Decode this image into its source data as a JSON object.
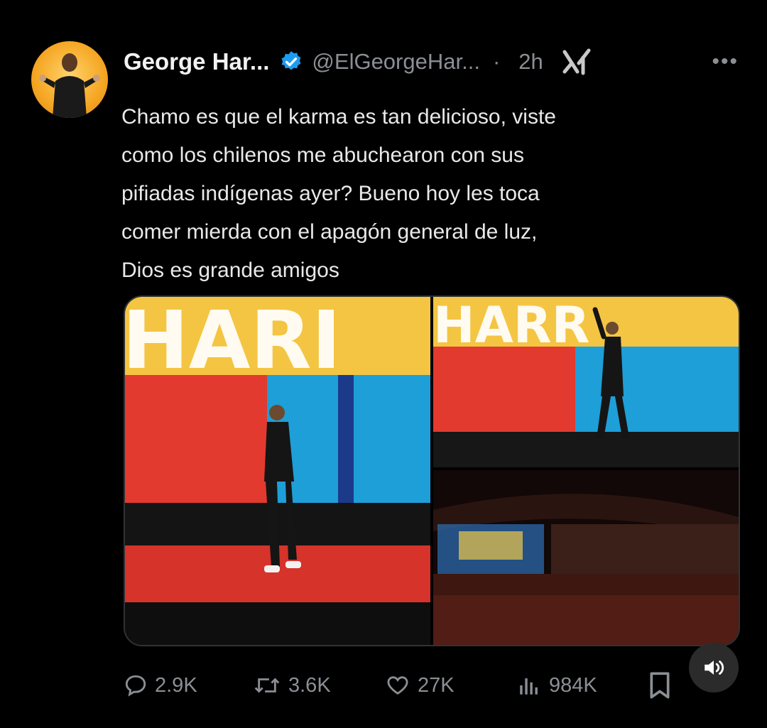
{
  "author": {
    "name": "George Har...",
    "handle": "@ElGeorgeHar...",
    "separator": "·",
    "time": "2h",
    "avatar_icon": "avatar-photo",
    "verified_color": "#1d9bf0"
  },
  "tweet": {
    "text": "Chamo es que el karma es tan delicioso, viste\ncomo los chilenos me abuchearon con sus\npifiadas indígenas ayer? Bueno hoy les toca\ncomer mierda con el apagón general de luz,\nDios es grande amigos"
  },
  "media": {
    "images": [
      {
        "icon": "stage-photo-left",
        "banner_text": "HARI"
      },
      {
        "icon": "stage-photo-right-top",
        "banner_text": "HARR"
      },
      {
        "icon": "arena-crowd-photo"
      }
    ]
  },
  "actions": {
    "reply_count": "2.9K",
    "retweet_count": "3.6K",
    "like_count": "27K",
    "views_count": "984K"
  },
  "controls": {
    "more_label": "•••",
    "sound_icon": "speaker-icon"
  },
  "colors": {
    "background": "#000000",
    "text": "#e7e9ea",
    "muted": "#8b8f94"
  }
}
